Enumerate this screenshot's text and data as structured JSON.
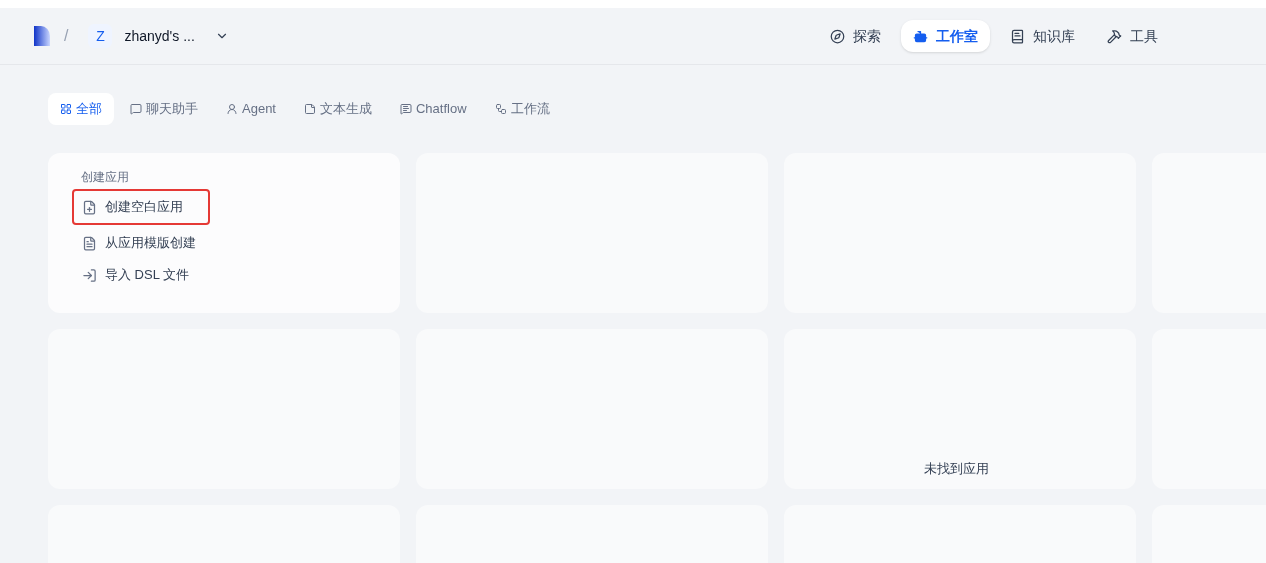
{
  "header": {
    "separator": "/",
    "workspace": {
      "initial": "Z",
      "name": "zhanyd's ..."
    },
    "nav": [
      {
        "label": "探索",
        "kind": "explore",
        "selected": false
      },
      {
        "label": "工作室",
        "kind": "studio",
        "selected": true
      },
      {
        "label": "知识库",
        "kind": "knowledge",
        "selected": false
      },
      {
        "label": "工具",
        "kind": "tools",
        "selected": false
      }
    ]
  },
  "filters": [
    {
      "label": "全部",
      "kind": "all",
      "selected": true
    },
    {
      "label": "聊天助手",
      "kind": "chat",
      "selected": false
    },
    {
      "label": "Agent",
      "kind": "agent",
      "selected": false
    },
    {
      "label": "文本生成",
      "kind": "text",
      "selected": false
    },
    {
      "label": "Chatflow",
      "kind": "chatflow",
      "selected": false
    },
    {
      "label": "工作流",
      "kind": "workflow",
      "selected": false
    }
  ],
  "create_card": {
    "title": "创建应用",
    "items": [
      {
        "label": "创建空白应用",
        "kind": "blank",
        "highlighted": true
      },
      {
        "label": "从应用模版创建",
        "kind": "template",
        "highlighted": false
      },
      {
        "label": "导入 DSL 文件",
        "kind": "import",
        "highlighted": false
      }
    ]
  },
  "empty_message": "未找到应用"
}
